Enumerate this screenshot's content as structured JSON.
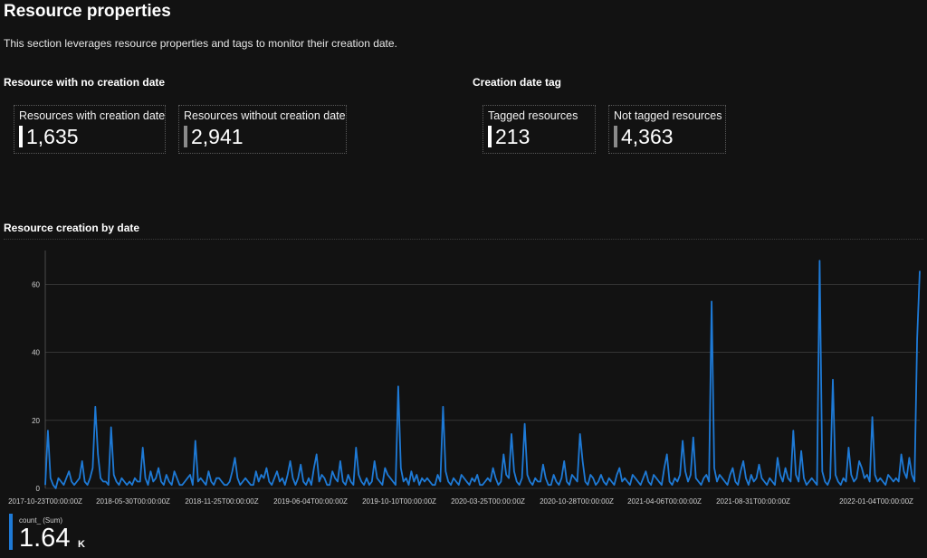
{
  "page": {
    "title": "Resource properties",
    "description": "This section leverages resource properties and tags to monitor their creation date."
  },
  "sections": {
    "no_creation_date": {
      "heading": "Resource with no creation date",
      "tiles": [
        {
          "label": "Resources with creation date",
          "value": "1,635",
          "color": "#ffffff"
        },
        {
          "label": "Resources without creation date",
          "value": "2,941",
          "color": "#8a8a8a"
        }
      ]
    },
    "creation_tag": {
      "heading": "Creation date tag",
      "tiles": [
        {
          "label": "Tagged resources",
          "value": "213",
          "color": "#ffffff"
        },
        {
          "label": "Not tagged resources",
          "value": "4,363",
          "color": "#8a8a8a"
        }
      ]
    }
  },
  "chart_section": {
    "title": "Resource creation by date",
    "legend_name": "count_ (Sum)",
    "legend_value": "1.64",
    "legend_unit": "K"
  },
  "colors": {
    "line": "#1e7ad6",
    "background": "#121212",
    "grid": "#4a4a4a"
  },
  "chart_data": {
    "type": "line",
    "x_tick_labels": [
      "2017-10-23T00:00:00Z",
      "2018-05-30T00:00:00Z",
      "2018-11-25T00:00:00Z",
      "2019-06-04T00:00:00Z",
      "2019-10-10T00:00:00Z",
      "2020-03-25T00:00:00Z",
      "2020-10-28T00:00:00Z",
      "2021-04-06T00:00:00Z",
      "2021-08-31T00:00:00Z",
      "2022-01-04T00:00:00Z"
    ],
    "y_ticks": [
      0,
      20,
      40,
      60
    ],
    "ylim": [
      0,
      70
    ],
    "grid": true,
    "series": [
      {
        "name": "count_ (Sum)",
        "color": "#1e7ad6",
        "values": [
          1,
          17,
          3,
          1,
          0,
          3,
          2,
          1,
          3,
          5,
          2,
          1,
          2,
          3,
          8,
          2,
          1,
          3,
          6,
          24,
          10,
          3,
          2,
          2,
          1,
          18,
          4,
          2,
          1,
          3,
          2,
          1,
          2,
          1,
          3,
          2,
          2,
          12,
          3,
          1,
          5,
          2,
          3,
          6,
          2,
          1,
          4,
          2,
          1,
          5,
          3,
          1,
          1,
          2,
          3,
          4,
          1,
          14,
          2,
          3,
          2,
          1,
          5,
          2,
          1,
          3,
          3,
          2,
          1,
          1,
          2,
          5,
          9,
          3,
          1,
          2,
          3,
          2,
          1,
          1,
          5,
          2,
          4,
          3,
          6,
          2,
          1,
          3,
          5,
          2,
          3,
          1,
          4,
          8,
          3,
          1,
          3,
          7,
          2,
          1,
          3,
          1,
          6,
          10,
          2,
          4,
          3,
          1,
          1,
          5,
          3,
          2,
          8,
          2,
          1,
          4,
          2,
          1,
          12,
          4,
          2,
          1,
          3,
          1,
          2,
          8,
          3,
          2,
          1,
          6,
          4,
          3,
          2,
          1,
          30,
          6,
          2,
          3,
          1,
          5,
          2,
          4,
          1,
          3,
          2,
          3,
          2,
          1,
          1,
          4,
          2,
          24,
          5,
          2,
          1,
          3,
          2,
          1,
          4,
          3,
          2,
          1,
          3,
          2,
          4,
          1,
          1,
          2,
          3,
          2,
          6,
          3,
          1,
          2,
          10,
          4,
          3,
          16,
          5,
          2,
          1,
          3,
          19,
          4,
          2,
          1,
          3,
          2,
          2,
          7,
          3,
          1,
          1,
          4,
          2,
          1,
          3,
          8,
          2,
          1,
          4,
          3,
          2,
          16,
          8,
          2,
          1,
          4,
          3,
          1,
          2,
          4,
          2,
          1,
          3,
          2,
          1,
          4,
          6,
          2,
          3,
          2,
          1,
          4,
          3,
          2,
          1,
          3,
          5,
          2,
          1,
          4,
          3,
          2,
          1,
          6,
          10,
          2,
          1,
          3,
          2,
          4,
          14,
          5,
          2,
          4,
          15,
          3,
          2,
          1,
          3,
          4,
          2,
          55,
          6,
          2,
          4,
          3,
          2,
          1,
          4,
          6,
          2,
          1,
          5,
          8,
          3,
          1,
          4,
          2,
          3,
          7,
          3,
          2,
          1,
          3,
          2,
          1,
          9,
          4,
          2,
          6,
          3,
          2,
          17,
          4,
          2,
          11,
          3,
          1,
          2,
          3,
          2,
          1,
          67,
          5,
          2,
          1,
          3,
          32,
          4,
          2,
          1,
          3,
          2,
          12,
          4,
          2,
          3,
          8,
          6,
          3,
          4,
          2,
          21,
          4,
          2,
          3,
          2,
          1,
          4,
          3,
          2,
          3,
          2,
          10,
          5,
          3,
          9,
          4,
          2,
          44,
          64
        ]
      }
    ]
  }
}
